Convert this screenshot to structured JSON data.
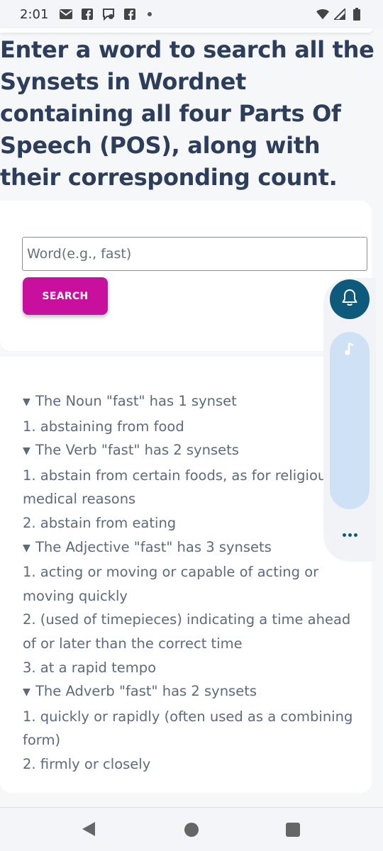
{
  "status_bar": {
    "time": "2:01",
    "icons_left": [
      "gmail-icon",
      "facebook-icon",
      "messenger-icon",
      "facebook-icon",
      "notification-dot"
    ],
    "icons_right": [
      "wifi-icon",
      "signal-icon",
      "battery-icon"
    ]
  },
  "headline": "Enter a word to search all the Synsets in Wordnet containing all four Parts Of Speech (POS), along with their corresponding count.",
  "search": {
    "placeholder": "Word(e.g., fast)",
    "value": "",
    "button_label": "SEARCH"
  },
  "results": [
    {
      "heading": "The Noun \"fast\" has 1 synset",
      "defs": [
        "1. abstaining from food"
      ]
    },
    {
      "heading": "The Verb \"fast\" has 2 synsets",
      "defs": [
        "1. abstain from certain foods, as for religiou or medical reasons",
        "2. abstain from eating"
      ]
    },
    {
      "heading": "The Adjective \"fast\" has 3 synsets",
      "defs": [
        "1. acting or moving or capable of acting or moving quickly",
        "2. (used of timepieces) indicating a time ahead of or later than the correct time",
        "3. at a rapid tempo"
      ]
    },
    {
      "heading": "The Adverb \"fast\" has 2 synsets",
      "defs": [
        "1. quickly or rapidly (often used as a combining form)",
        "2. firmly or closely"
      ]
    }
  ],
  "colors": {
    "headline": "#2c3e5c",
    "button": "#c90f9e",
    "results_text": "#5d6a7c",
    "bell_button": "#0e5a7c",
    "slider": "#cfe2f5"
  }
}
